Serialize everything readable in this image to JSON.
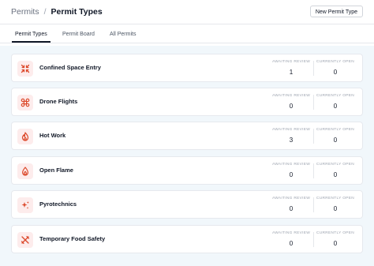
{
  "breadcrumb": {
    "parent": "Permits",
    "separator": "/",
    "current": "Permit Types"
  },
  "actions": {
    "new_label": "New Permit Type"
  },
  "tabs": [
    {
      "label": "Permit Types",
      "active": true
    },
    {
      "label": "Permit Board",
      "active": false
    },
    {
      "label": "All Permits",
      "active": false
    }
  ],
  "stat_labels": {
    "awaiting": "AWAITING REVIEW",
    "open": "CURRENTLY OPEN"
  },
  "colors": {
    "icon": "#dc4a2c",
    "icon_bg": "#fdecec"
  },
  "permit_types": [
    {
      "name": "Confined Space Entry",
      "icon": "compress-arrows-icon",
      "awaiting": "1",
      "open": "0"
    },
    {
      "name": "Drone Flights",
      "icon": "drone-icon",
      "awaiting": "0",
      "open": "0"
    },
    {
      "name": "Hot Work",
      "icon": "fire-icon",
      "awaiting": "3",
      "open": "0"
    },
    {
      "name": "Open Flame",
      "icon": "flame-icon",
      "awaiting": "0",
      "open": "0"
    },
    {
      "name": "Pyrotechnics",
      "icon": "sparkles-icon",
      "awaiting": "0",
      "open": "0"
    },
    {
      "name": "Temporary Food Safety",
      "icon": "utensils-icon",
      "awaiting": "0",
      "open": "0"
    }
  ]
}
